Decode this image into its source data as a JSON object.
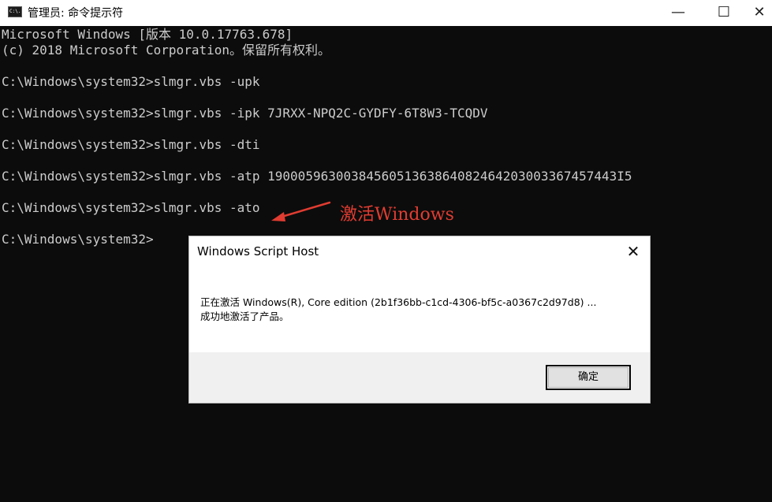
{
  "window": {
    "title": "管理员: 命令提示符",
    "app_icon_text": "C:\\."
  },
  "controls": {
    "minimize": "—",
    "maximize": "☐",
    "close": "✕"
  },
  "terminal": {
    "lines": [
      "Microsoft Windows [版本 10.0.17763.678]",
      "(c) 2018 Microsoft Corporation。保留所有权利。",
      "C:\\Windows\\system32>slmgr.vbs -upk",
      "C:\\Windows\\system32>slmgr.vbs -ipk 7JRXX-NPQ2C-GYDFY-6T8W3-TCQDV",
      "C:\\Windows\\system32>slmgr.vbs -dti",
      "C:\\Windows\\system32>slmgr.vbs -atp 1900059630038456051363864082464203003367457443I5",
      "C:\\Windows\\system32>slmgr.vbs -ato",
      "C:\\Windows\\system32>"
    ]
  },
  "annotation": {
    "text": "激活Windows",
    "color": "#e03c31"
  },
  "dialog": {
    "title": "Windows Script Host",
    "close": "✕",
    "message_line1": "正在激活 Windows(R), Core edition (2b1f36bb-c1cd-4306-bf5c-a0367c2d97d8) ...",
    "message_line2": "成功地激活了产品。",
    "ok_label": "确定"
  }
}
